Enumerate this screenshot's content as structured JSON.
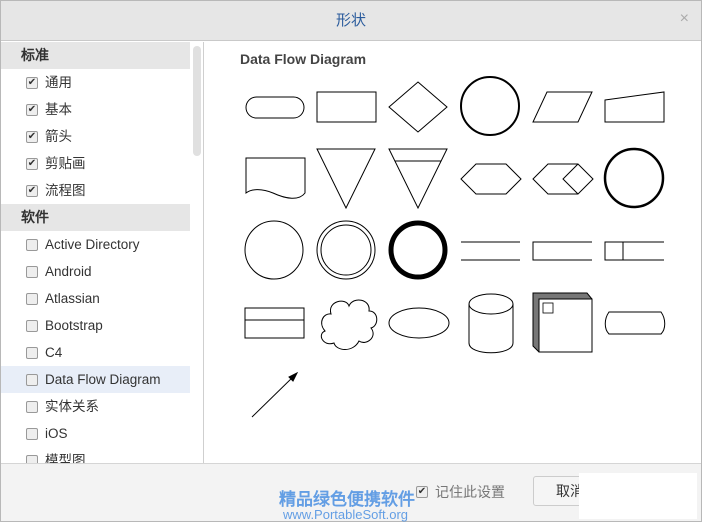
{
  "dialog": {
    "title": "形状",
    "close_icon": "×"
  },
  "sidebar": {
    "groups": [
      {
        "label": "标准",
        "items": [
          {
            "label": "通用",
            "checked": true
          },
          {
            "label": "基本",
            "checked": true
          },
          {
            "label": "箭头",
            "checked": true
          },
          {
            "label": "剪贴画",
            "checked": true
          },
          {
            "label": "流程图",
            "checked": true
          }
        ]
      },
      {
        "label": "软件",
        "items": [
          {
            "label": "Active Directory",
            "checked": false
          },
          {
            "label": "Android",
            "checked": false
          },
          {
            "label": "Atlassian",
            "checked": false
          },
          {
            "label": "Bootstrap",
            "checked": false
          },
          {
            "label": "C4",
            "checked": false
          },
          {
            "label": "Data Flow Diagram",
            "checked": false,
            "selected": true
          },
          {
            "label": "实体关系",
            "checked": false
          },
          {
            "label": "iOS",
            "checked": false
          },
          {
            "label": "模型图",
            "checked": false
          }
        ]
      }
    ]
  },
  "main": {
    "section_title": "Data Flow Diagram"
  },
  "footer": {
    "remember_label": "记住此设置",
    "remember_checked": true,
    "cancel_label": "取消"
  },
  "watermark": {
    "line1": "精品绿色便携软件",
    "line2": "www.PortableSoft.org"
  }
}
